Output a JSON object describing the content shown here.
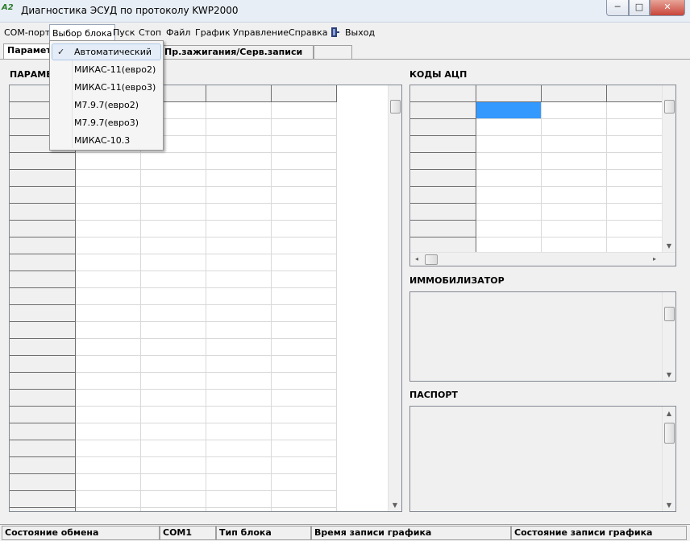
{
  "window": {
    "title": "Диагностика ЭСУД по протоколу KWP2000",
    "icon": "A2",
    "min": "─",
    "max": "□",
    "close": "✕"
  },
  "menu": [
    "COM-порт",
    "Выбор блока",
    "Пуск",
    "Стоп",
    "Файл",
    "График",
    "Управление",
    "Справка",
    "Выход"
  ],
  "tabs": [
    "Парамет",
    "Пр.зажигания/Серв.записи",
    ""
  ],
  "dropdown": {
    "items": [
      "Автоматический",
      "МИКАС-11(евро2)",
      "МИКАС-11(евро3)",
      "М7.9.7(евро2)",
      "М7.9.7(евро3)",
      "МИКАС-10.3"
    ],
    "checked_index": 0,
    "check_mark": "✓"
  },
  "sections": {
    "params": "ПАРАМЕ",
    "adc": "КОДЫ АЦП",
    "immo": "ИММОБИЛИЗАТОР",
    "passport": "ПАСПОРТ"
  },
  "statusbar": [
    "Состояние обмена",
    "COM1",
    "Тип блока",
    "Время записи графика",
    "Состояние записи графика"
  ],
  "icons": {
    "exit": "exit-door-icon",
    "check": "checkmark-icon"
  }
}
